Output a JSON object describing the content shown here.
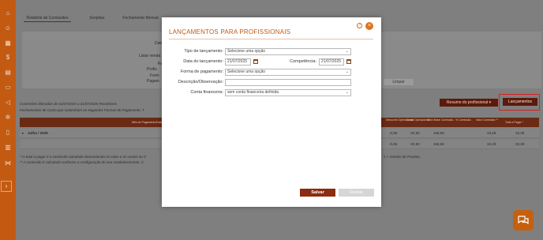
{
  "background": {
    "tabs": [
      "Relatório de Comissões",
      "Gorjetas",
      "Fechamento Mensal"
    ],
    "filter_labels": [
      "Data da L",
      "Listar venda",
      "Re",
      "Profis",
      "Form",
      "Pagam"
    ],
    "limpar": "Limpar",
    "info_line1": "Comissões liberadas de 01/07/2025 a 31/07/2025 Recebíveis",
    "info_line2": "Fechamentos de Conta que contenham as seguintes Formas de Pagamento: T",
    "resumo_label": "Resumo do profissional",
    "lancamentos_label": "Lançamentos",
    "grid_header": {
      "col1": "Mês do Pagamento/Data",
      "col2": "Desconto Operacional",
      "col3": "Custo Operacional",
      "col4": "Valor Base Comissão",
      "col5": "% Comissão",
      "col6": "Valor Comissão **",
      "col7": "Total a Pagar *"
    },
    "row1": {
      "label": "Julho / 2025",
      "v1": "-0,85",
      "v2": "-32,60",
      "v3": "166,59",
      "v4": "33,28",
      "v5": "33,28"
    },
    "row2": {
      "v1": "-0,85",
      "v2": "-32,60",
      "v3": "166,59",
      "v4": "33,28",
      "v5": "33,28"
    },
    "footnote1": "* O total a pagar é a comissão calculada descontando os vales e os custos ou d",
    "footnote2": "** A comissão é calculada conforme a configuração do seu estabelecimento. C",
    "footnote_right": "s > Vendas de Produto."
  },
  "modal": {
    "title": "LANÇAMENTOS PARA PROFISSIONAIS",
    "fields": {
      "tipo_label": "Tipo de lançamento:",
      "tipo_value": "Selecione uma opção",
      "data_label": "Data do lançamento:",
      "data_value": "21/07/2025",
      "competencia_label": "Competência:",
      "competencia_value": "21/07/2025",
      "forma_label": "Forma de pagamento:",
      "forma_value": "Selecione uma opção",
      "descricao_label": "Descrição/Observação:",
      "descricao_value": "",
      "conta_label": "Conta financeira:",
      "conta_value": "sem conta financeira definida"
    },
    "save_label": "Salvar",
    "close_label": "Fechar"
  },
  "colors": {
    "accent": "#c25a12",
    "dark_accent": "#5b1a0b",
    "save": "#8b2d10",
    "highlight": "#e11d1d"
  }
}
